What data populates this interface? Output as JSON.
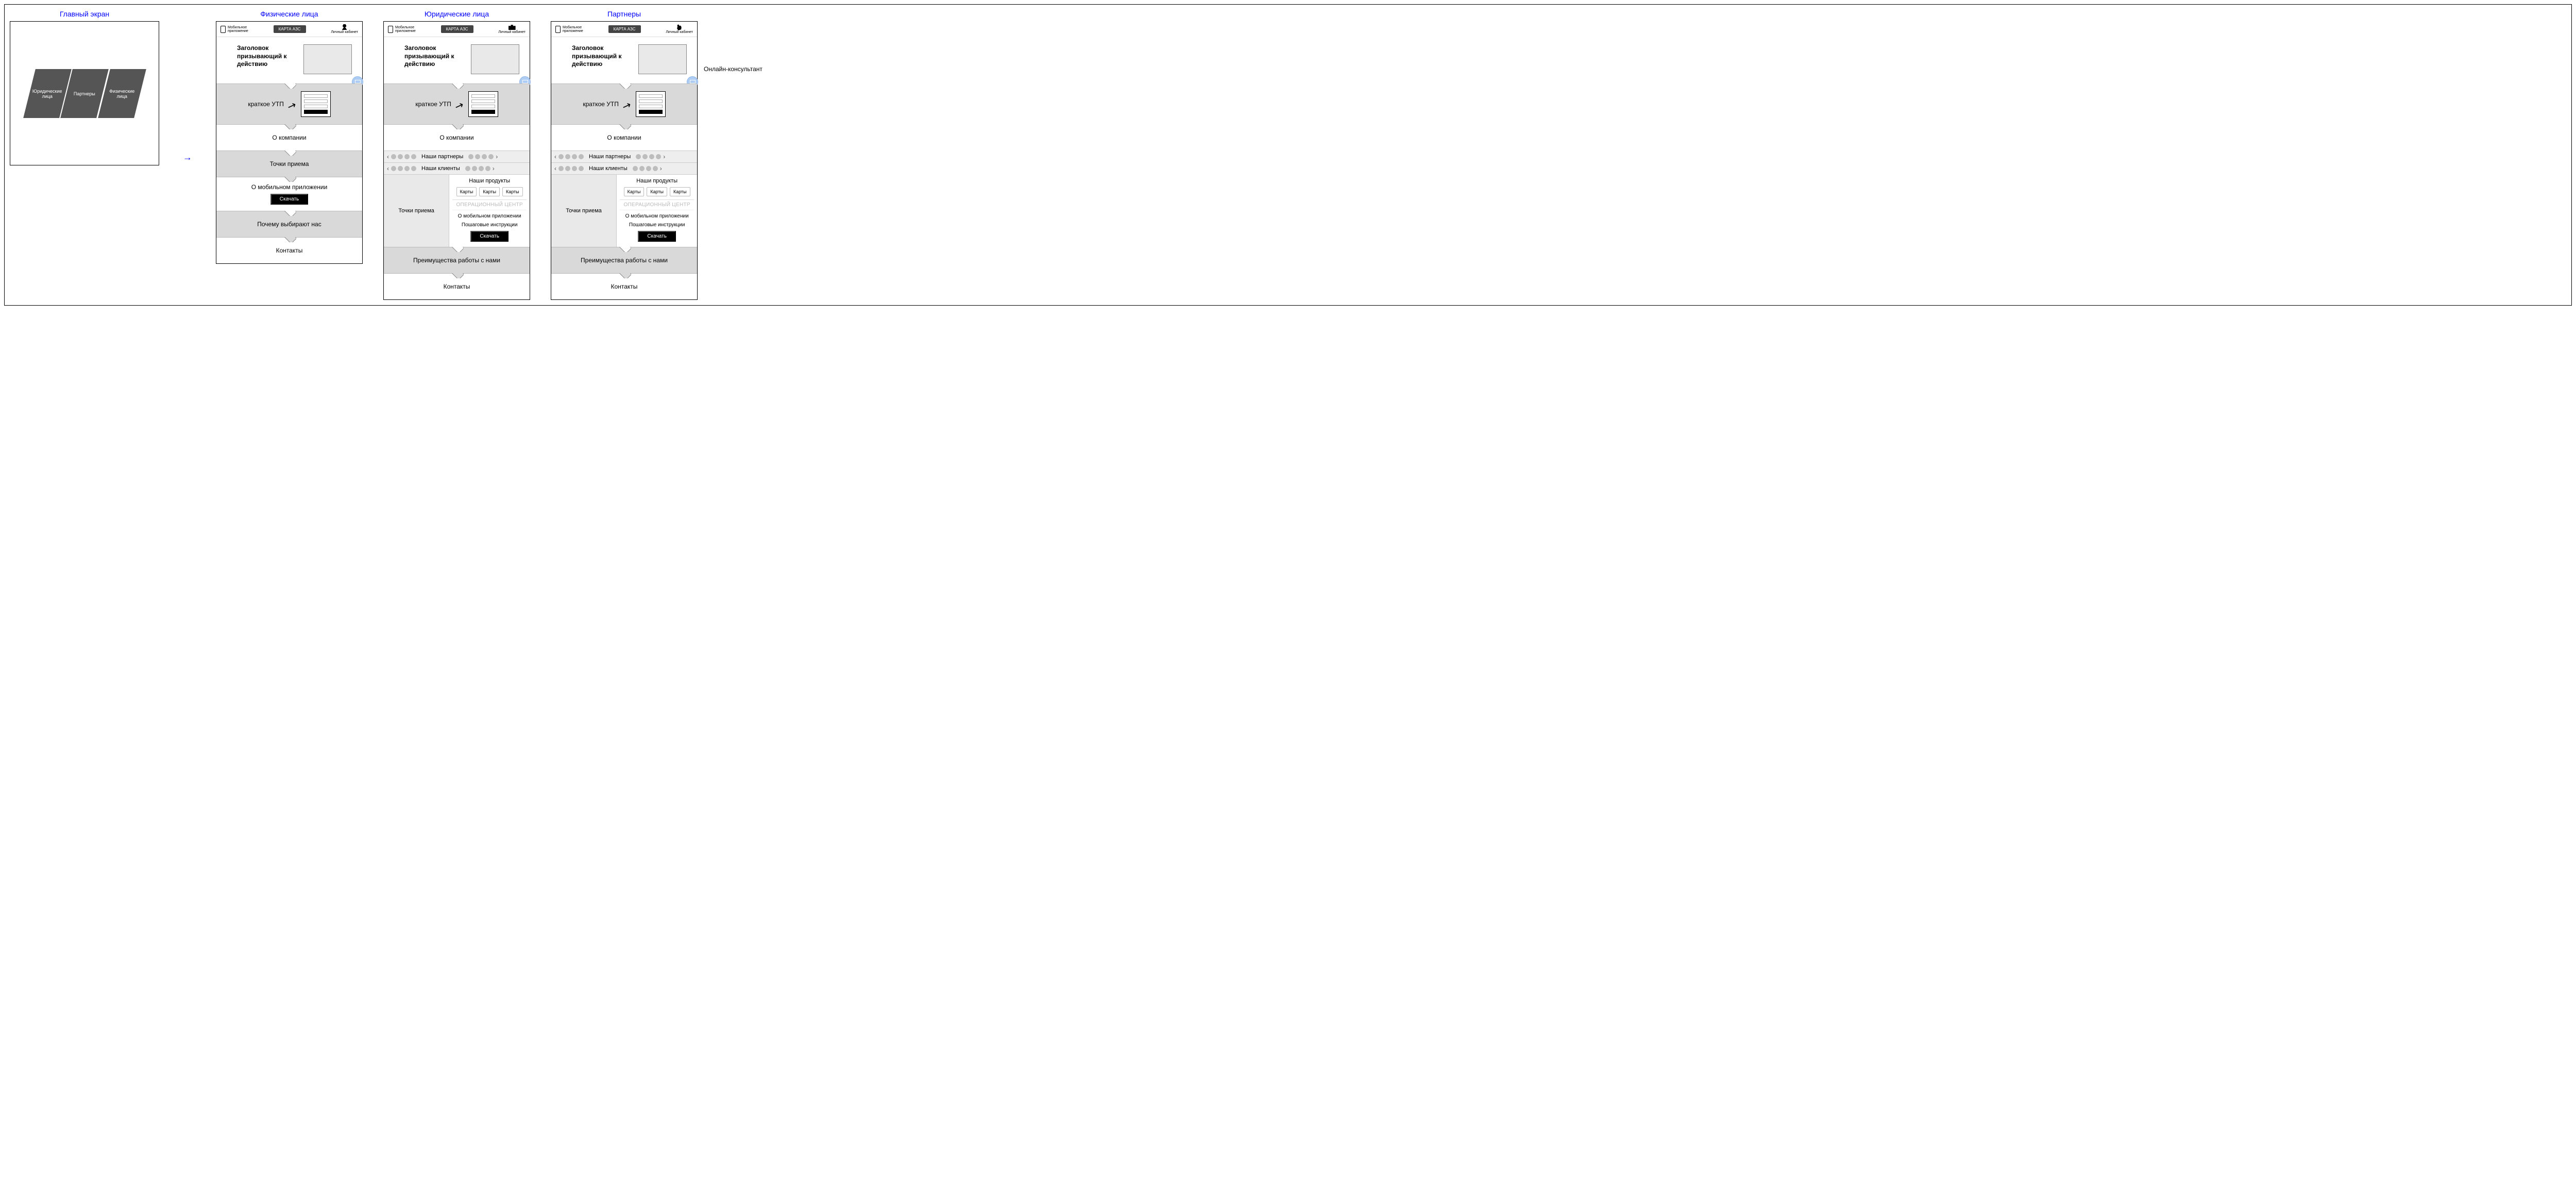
{
  "titles": {
    "main": "Главный экран",
    "individuals": "Физические лица",
    "legal": "Юридические лица",
    "partners": "Партнеры"
  },
  "main_tiles": {
    "a": "Юридические лица",
    "b": "Партнеры",
    "c": "Физические лица"
  },
  "header": {
    "app_label": "Мобильное\nприложение",
    "badge": "КАРТА АЗС",
    "cabinet": "Личный кабинет"
  },
  "hero": {
    "text": "Заголовок призывающий к действию"
  },
  "utp": {
    "label": "краткое УТП"
  },
  "sections": {
    "about": "О компании",
    "points": "Точки приема",
    "mobile": "О мобильном приложении",
    "download": "Скачать",
    "why": "Почему выбирают нас",
    "contacts": "Контакты",
    "adv": "Преимущества работы с нами"
  },
  "carousel": {
    "partners": "Наши партнеры",
    "clients": "Наши клиенты"
  },
  "products": {
    "title": "Наши продукты",
    "chip": "Карты",
    "op_center": "ОПЕРАЦИОННЫЙ ЦЕНТР",
    "mobile": "О мобильном приложении",
    "steps": "Пошаговые инструкции"
  },
  "sidenote": "Онлайн-консультант"
}
